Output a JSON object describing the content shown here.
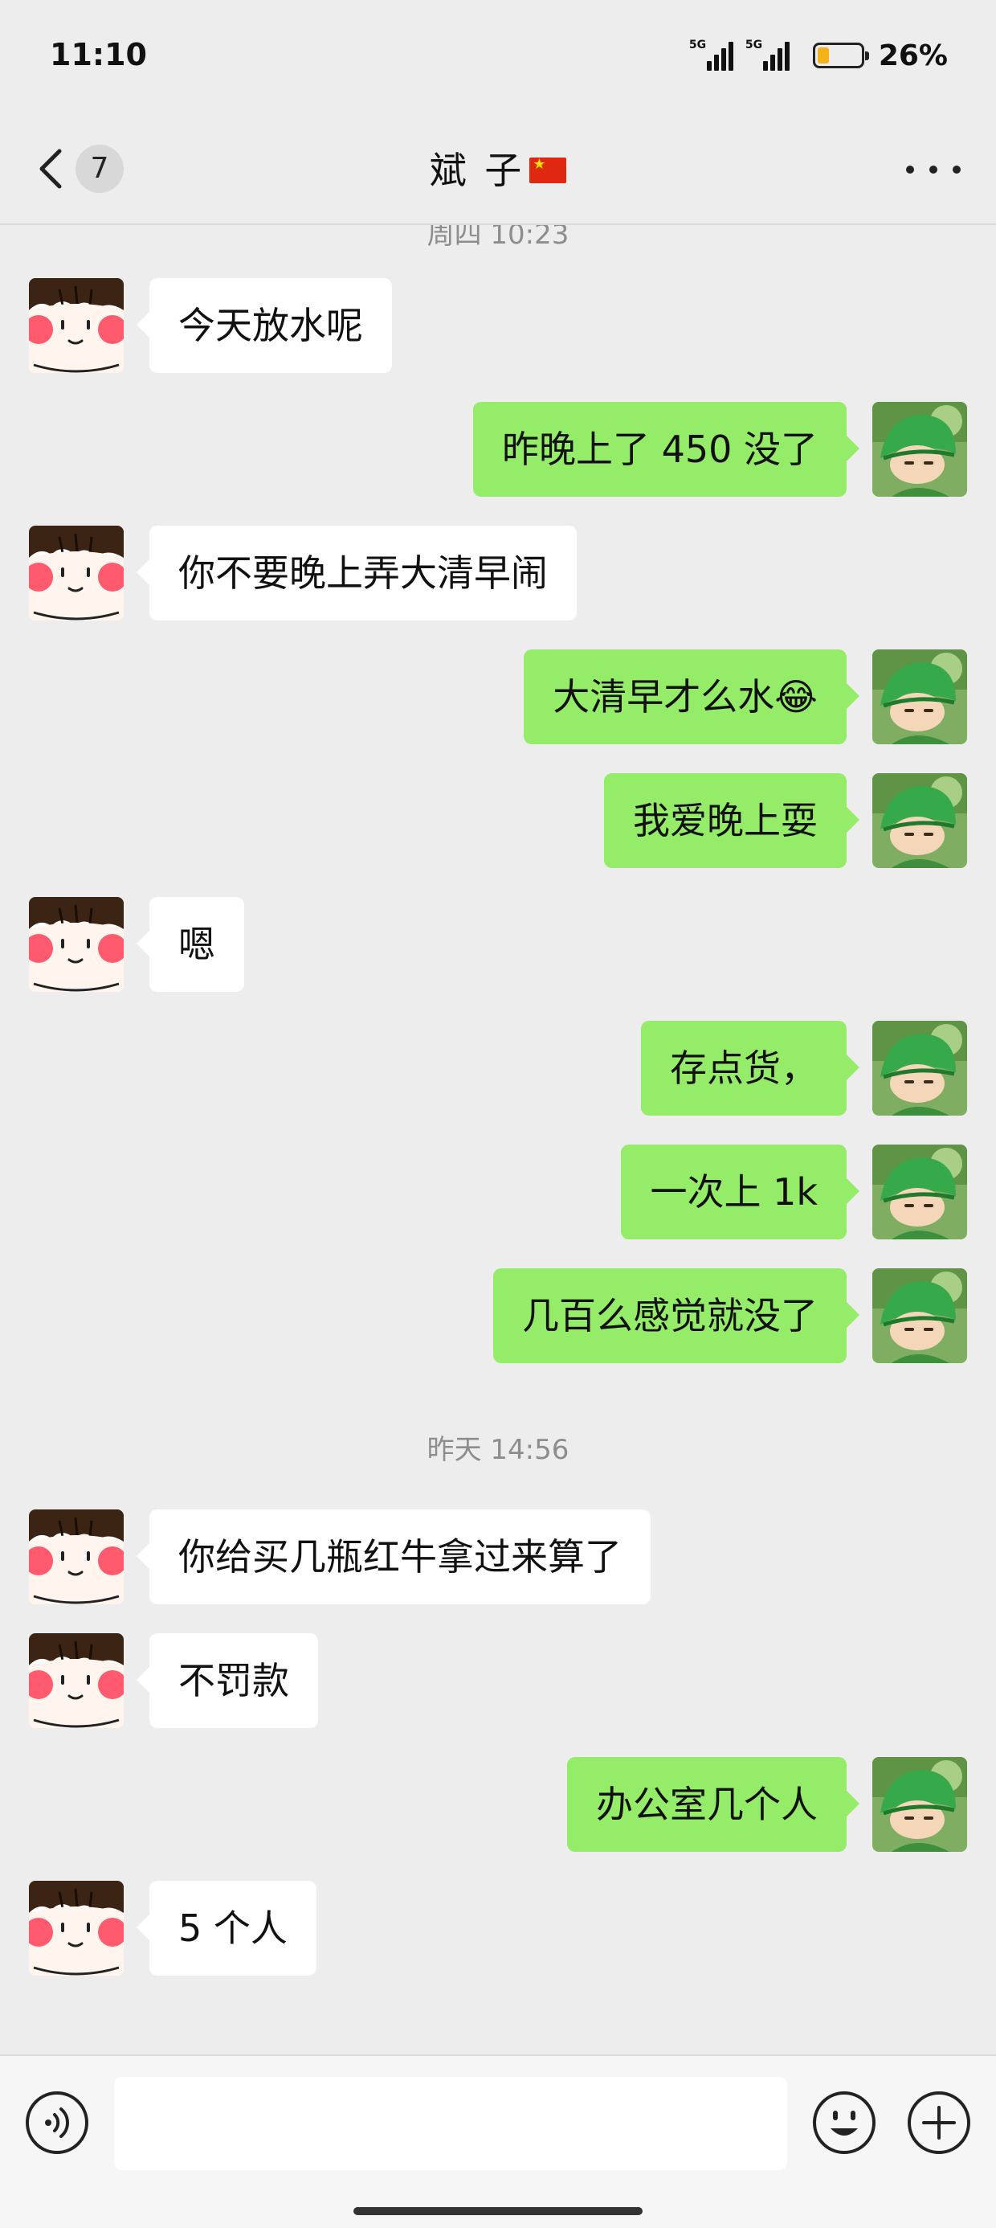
{
  "status_bar": {
    "time": "11:10",
    "signal1_label": "5G",
    "signal2_label": "5G",
    "battery_percent_text": "26%",
    "battery_level": 0.26,
    "battery_color": "#f3b21a"
  },
  "nav": {
    "back_icon": "chevron-left-icon",
    "unread_count": "7",
    "title": "斌 子",
    "title_flag": "china-flag-icon",
    "more_icon": "more-dots-icon"
  },
  "colors": {
    "background": "#ededed",
    "incoming_bubble": "#ffffff",
    "outgoing_bubble": "#95ec69"
  },
  "messages": [
    {
      "type": "timestamp",
      "text": "周四 10:23"
    },
    {
      "type": "in",
      "text": "今天放水呢"
    },
    {
      "type": "out",
      "text": "昨晚上了 450 没了"
    },
    {
      "type": "in",
      "text": "你不要晚上弄大清早闹"
    },
    {
      "type": "out",
      "text": "大清早才么水😂"
    },
    {
      "type": "out",
      "text": "我爱晚上耍"
    },
    {
      "type": "in",
      "text": "嗯"
    },
    {
      "type": "out",
      "text": "存点货，"
    },
    {
      "type": "out",
      "text": "一次上 1k"
    },
    {
      "type": "out",
      "text": "几百么感觉就没了"
    },
    {
      "type": "timestamp",
      "text": "昨天 14:56"
    },
    {
      "type": "in",
      "text": "你给买几瓶红牛拿过来算了"
    },
    {
      "type": "in",
      "text": "不罚款"
    },
    {
      "type": "out",
      "text": "办公室几个人"
    },
    {
      "type": "in",
      "text": "5 个人"
    }
  ],
  "input_bar": {
    "voice_icon": "voice-icon",
    "text_value": "",
    "emoji_icon": "emoji-icon",
    "plus_icon": "plus-icon"
  }
}
